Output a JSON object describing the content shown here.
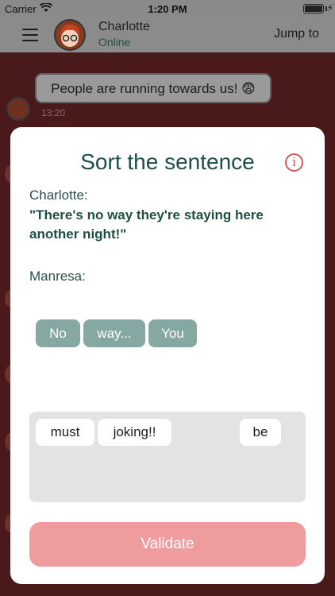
{
  "status_bar": {
    "carrier": "Carrier",
    "time": "1:20 PM"
  },
  "header": {
    "contact_name": "Charlotte",
    "contact_status": "Online",
    "jump_to": "Jump to"
  },
  "chat": {
    "bubble_text": "People are running towards us! 😨",
    "timestamp": "13:20"
  },
  "modal": {
    "title": "Sort the sentence",
    "speaker_1": "Charlotte:",
    "quote": "\"There's no way they're staying here another night!\"",
    "speaker_2": "Manresa:",
    "answer_chips": [
      "No",
      "way...",
      "You"
    ],
    "word_pool": [
      "must",
      "joking!!",
      "be"
    ],
    "validate_label": "Validate"
  },
  "colors": {
    "accent": "#1e4f46",
    "chip": "#86a8a3",
    "validate": "#ef9c9e",
    "info": "#d05a5a"
  }
}
